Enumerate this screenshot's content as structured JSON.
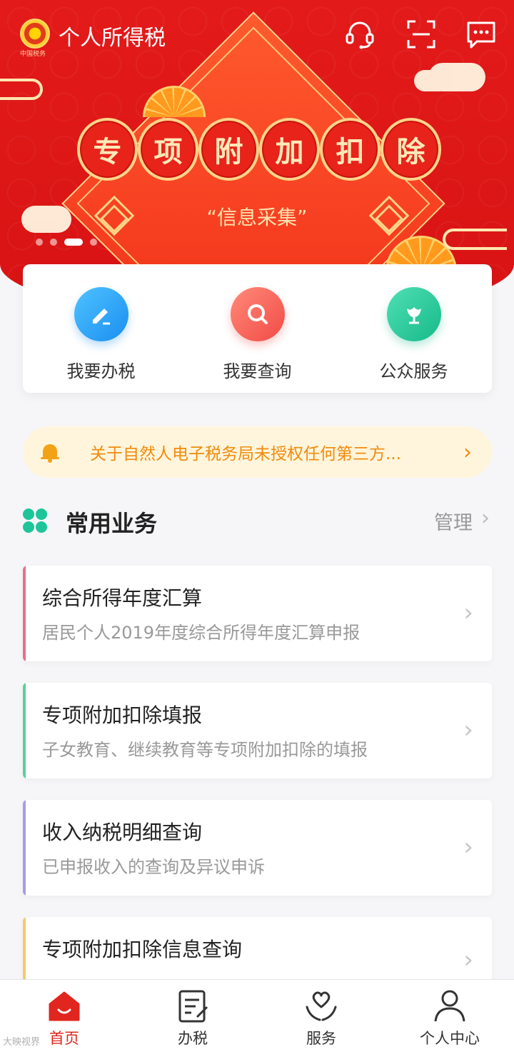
{
  "app": {
    "title": "个人所得税",
    "emblem_caption": "中国税务"
  },
  "topbar": {
    "icons": [
      "headset-icon",
      "scan-icon",
      "message-icon"
    ]
  },
  "banner": {
    "characters": [
      "专",
      "项",
      "附",
      "加",
      "扣",
      "除"
    ],
    "subtitle": "“信息采集”",
    "slide_count": 4,
    "active_slide": 3
  },
  "quick_actions": [
    {
      "label": "我要办税",
      "icon": "pencil-icon",
      "color": "#1a8ef0"
    },
    {
      "label": "我要查询",
      "icon": "magnifier-icon",
      "color": "#f24b45"
    },
    {
      "label": "公众服务",
      "icon": "tulip-icon",
      "color": "#17b98a"
    }
  ],
  "notice": {
    "text": "关于自然人电子税务局未授权任何第三方...",
    "icon": "bell-icon",
    "color": "#f08b0c"
  },
  "common_services": {
    "title": "常用业务",
    "manage_label": "管理",
    "items": [
      {
        "title": "综合所得年度汇算",
        "subtitle": "居民个人2019年度综合所得年度汇算申报",
        "accent": "#ec6d8a"
      },
      {
        "title": "专项附加扣除填报",
        "subtitle": "子女教育、继续教育等专项附加扣除的填报",
        "accent": "#55d29a"
      },
      {
        "title": "收入纳税明细查询",
        "subtitle": "已申报收入的查询及异议申诉",
        "accent": "#a79ce6"
      },
      {
        "title": "专项附加扣除信息查询",
        "subtitle": "",
        "accent": "#f5c971"
      }
    ]
  },
  "bottom_nav": [
    {
      "label": "首页",
      "icon": "home-icon",
      "active": true
    },
    {
      "label": "办税",
      "icon": "form-icon",
      "active": false
    },
    {
      "label": "服务",
      "icon": "heart-hands-icon",
      "active": false
    },
    {
      "label": "个人中心",
      "icon": "person-icon",
      "active": false
    }
  ],
  "watermark": "大映视界",
  "colors": {
    "brand_red": "#e0261e",
    "background": "#f6f6f8"
  }
}
